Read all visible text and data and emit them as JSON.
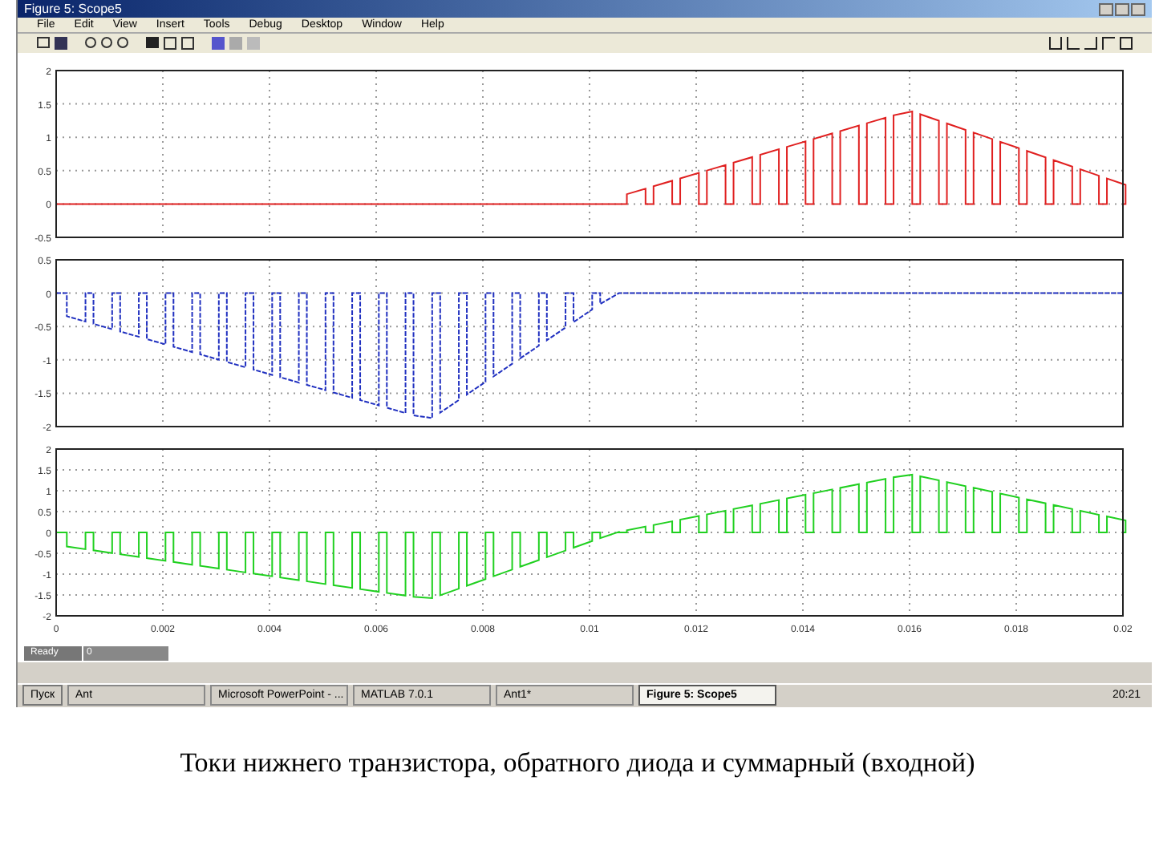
{
  "window": {
    "title": "Figure 5: Scope5"
  },
  "menu": [
    "File",
    "Edit",
    "View",
    "Insert",
    "Tools",
    "Debug",
    "Desktop",
    "Window",
    "Help"
  ],
  "axes": [
    {
      "color": "#e02020",
      "dashed": false,
      "yticks": [
        "2",
        "1.5",
        "1",
        "0.5",
        "0",
        "-0.5"
      ]
    },
    {
      "color": "#2030c0",
      "dashed": true,
      "yticks": [
        "0.5",
        "0",
        "-0.5",
        "-1",
        "-1.5",
        "-2"
      ]
    },
    {
      "color": "#20d020",
      "dashed": false,
      "yticks": [
        "2",
        "1.5",
        "1",
        "0.5",
        "0",
        "-0.5",
        "-1",
        "-1.5",
        "-2"
      ]
    }
  ],
  "xticks": [
    "0",
    "0.002",
    "0.004",
    "0.006",
    "0.008",
    "0.01",
    "0.012",
    "0.014",
    "0.016",
    "0.018",
    "0.02"
  ],
  "status_bar": {
    "text": "Ready",
    "value": "0"
  },
  "taskbar": {
    "start": "Пуск",
    "items": [
      {
        "label": "Ant",
        "selected": false
      },
      {
        "label": "Microsoft PowerPoint - ...",
        "selected": false
      },
      {
        "label": "MATLAB 7.0.1",
        "selected": false
      },
      {
        "label": "Ant1*",
        "selected": false
      },
      {
        "label": "Figure 5: Scope5",
        "selected": true
      }
    ],
    "clock": "20:21"
  },
  "caption": "Токи нижнего транзистора, обратного диода и суммарный (входной)"
}
